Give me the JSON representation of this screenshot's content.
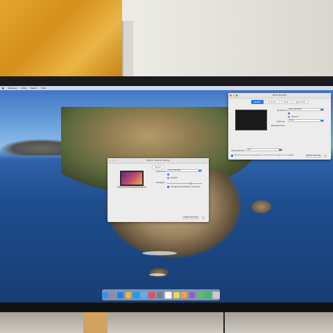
{
  "menubar": {
    "apple": "",
    "app": "Rainbow",
    "items": [
      "Rainbow",
      "Datei",
      "Bearb",
      "Hilfe"
    ]
  },
  "window_main": {
    "title": "BenQ BL3200",
    "tabs": [
      "Monitor",
      "Anordnen",
      "Farbe",
      "Night Shift"
    ],
    "resolution_label": "Optimieren:",
    "resolution_value": "BenQ BL3200",
    "scaled_label": "Skaliert",
    "rotation_label": "Drehung:",
    "rotation_value": "Ohne",
    "refresh_label": "Bildwiederholrate:",
    "airplay_label": "AirPlay-Monitor:",
    "airplay_value": "Aus",
    "mirror_label": "Bildschirmsynchronisierungsoptionen in der Menüleiste anzeigen, wenn verfügbar",
    "help_button": "Farben sammeln"
  },
  "window_second": {
    "title": "Built-in Retina Display",
    "tab": "Monitor",
    "resolution_label": "Optimieren:",
    "resolution_value": "BenQ BL3200",
    "scaled_label": "Skaliert",
    "brightness_label": "Helligkeit:",
    "auto_brightness_label": "Helligkeit automatisch anpassen",
    "gather_button": "Farben sammeln"
  },
  "dock": {
    "icons": [
      "finder-icon",
      "launchpad-icon",
      "safari-icon",
      "photos-icon",
      "appstore-icon",
      "mail-icon",
      "music-icon",
      "preferences-icon",
      "calendar-icon",
      "notes-icon",
      "reminders-icon",
      "podcasts-icon",
      "maps-icon",
      "facetime-icon",
      "trash-icon"
    ],
    "colors": [
      "#3f8df2",
      "#8f8f95",
      "#2a7bf0",
      "#e9b73c",
      "#1d9bf0",
      "#4db6f6",
      "#f04a5e",
      "#7d7d80",
      "#ffffff",
      "#f5d547",
      "#ff9f33",
      "#9b59d0",
      "#5bbf63",
      "#36c25a",
      "#c9c9cc"
    ]
  }
}
